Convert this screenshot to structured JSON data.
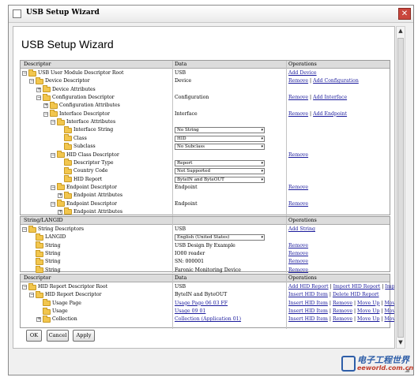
{
  "window": {
    "title": "USB Setup Wizard",
    "close_glyph": "✕"
  },
  "heading": "USB Setup Wizard",
  "descriptor_panel": {
    "columns": [
      "Descriptor",
      "Data",
      "Operations"
    ],
    "rows": [
      {
        "level": 0,
        "exp": "−",
        "label": "USB User Module Descriptor Root",
        "data": "USB",
        "data_type": "text",
        "ops": [
          {
            "label": "Add Device",
            "link": true
          }
        ]
      },
      {
        "level": 1,
        "exp": "−",
        "label": "Device Descriptor",
        "data": "Device",
        "data_type": "text",
        "ops": [
          {
            "label": "Remove",
            "link": true
          },
          {
            "label": " | ",
            "link": false
          },
          {
            "label": "Add Configuration",
            "link": true
          }
        ]
      },
      {
        "level": 2,
        "exp": "+",
        "label": "Device Attributes",
        "data": "",
        "data_type": "text",
        "ops": []
      },
      {
        "level": 2,
        "exp": "−",
        "label": "Configuration Descriptor",
        "data": "Configuration",
        "data_type": "text",
        "ops": [
          {
            "label": "Remove",
            "link": true
          },
          {
            "label": " | ",
            "link": false
          },
          {
            "label": "Add Interface",
            "link": true
          }
        ]
      },
      {
        "level": 3,
        "exp": "+",
        "label": "Configuration Attributes",
        "data": "",
        "data_type": "text",
        "ops": []
      },
      {
        "level": 3,
        "exp": "−",
        "label": "Interface Descriptor",
        "data": "Interface",
        "data_type": "text",
        "ops": [
          {
            "label": "Remove",
            "link": true
          },
          {
            "label": " | ",
            "link": false
          },
          {
            "label": "Add Endpoint",
            "link": true
          }
        ]
      },
      {
        "level": 4,
        "exp": "−",
        "label": "Interface Attributes",
        "data": "",
        "data_type": "text",
        "ops": []
      },
      {
        "level": 5,
        "exp": "",
        "label": "Interface String",
        "data": "No String",
        "data_type": "select",
        "ops": []
      },
      {
        "level": 5,
        "exp": "",
        "label": "Class",
        "data": "HID",
        "data_type": "select",
        "ops": []
      },
      {
        "level": 5,
        "exp": "",
        "label": "Subclass",
        "data": "No Subclass",
        "data_type": "select",
        "ops": []
      },
      {
        "level": 4,
        "exp": "−",
        "label": "HID Class Descriptor",
        "data": "",
        "data_type": "text",
        "ops": [
          {
            "label": "Remove",
            "link": true
          }
        ]
      },
      {
        "level": 5,
        "exp": "",
        "label": "Descriptor Type",
        "data": "Report",
        "data_type": "select",
        "ops": []
      },
      {
        "level": 5,
        "exp": "",
        "label": "Country Code",
        "data": "Not Supported",
        "data_type": "select",
        "ops": []
      },
      {
        "level": 5,
        "exp": "",
        "label": "HID Report",
        "data": "ByteIN and ByteOUT",
        "data_type": "select",
        "ops": []
      },
      {
        "level": 4,
        "exp": "−",
        "label": "Endpoint Descriptor",
        "data": "Endpoint",
        "data_type": "text",
        "ops": [
          {
            "label": "Remove",
            "link": true
          }
        ]
      },
      {
        "level": 5,
        "exp": "+",
        "label": "Endpoint Attributes",
        "data": "",
        "data_type": "text",
        "ops": []
      },
      {
        "level": 4,
        "exp": "−",
        "label": "Endpoint Descriptor",
        "data": "Endpoint",
        "data_type": "text",
        "ops": [
          {
            "label": "Remove",
            "link": true
          }
        ]
      },
      {
        "level": 5,
        "exp": "+",
        "label": "Endpoint Attributes",
        "data": "",
        "data_type": "text",
        "ops": []
      }
    ]
  },
  "string_panel": {
    "columns": [
      "String/LANGID",
      "",
      "Operations"
    ],
    "rows": [
      {
        "level": 0,
        "exp": "−",
        "label": "String Descriptors",
        "data": "USB",
        "data_type": "text",
        "ops": [
          {
            "label": "Add String",
            "link": true
          }
        ]
      },
      {
        "level": 1,
        "exp": "",
        "label": "LANGID",
        "data": "English (United States)",
        "data_type": "select",
        "ops": []
      },
      {
        "level": 1,
        "exp": "",
        "label": "String",
        "data": "USB Design By Example",
        "data_type": "text",
        "ops": [
          {
            "label": "Remove",
            "link": true
          }
        ]
      },
      {
        "level": 1,
        "exp": "",
        "label": "String",
        "data": "IO00 reader",
        "data_type": "text",
        "ops": [
          {
            "label": "Remove",
            "link": true
          }
        ]
      },
      {
        "level": 1,
        "exp": "",
        "label": "String",
        "data": "SN: 000001",
        "data_type": "text",
        "ops": [
          {
            "label": "Remove",
            "link": true
          }
        ]
      },
      {
        "level": 1,
        "exp": "",
        "label": "String",
        "data": "Faronic Monitoring Device",
        "data_type": "text",
        "ops": [
          {
            "label": "Remove",
            "link": true
          }
        ]
      }
    ]
  },
  "hid_panel": {
    "columns": [
      "Descriptor",
      "Data",
      "Operations"
    ],
    "rows": [
      {
        "level": 0,
        "exp": "−",
        "label": "HID Report Descriptor Root",
        "data": "USB",
        "data_type": "text",
        "ops": [
          {
            "label": "Add HID Report",
            "link": true
          },
          {
            "label": " | ",
            "link": false
          },
          {
            "label": "Import HID Report",
            "link": true
          },
          {
            "label": " | ",
            "link": false
          },
          {
            "label": "Import HID Report Template",
            "link": true
          }
        ]
      },
      {
        "level": 1,
        "exp": "−",
        "label": "HID Report Descriptor",
        "data": "ByteIN and ByteOUT",
        "data_type": "text",
        "ops": [
          {
            "label": "Insert HID Item",
            "link": true
          },
          {
            "label": " | ",
            "link": false
          },
          {
            "label": "Delete HID Report",
            "link": true
          }
        ]
      },
      {
        "level": 2,
        "exp": "",
        "label": "Usage Page",
        "data": "Usage Page 06 03 FF",
        "data_type": "link",
        "ops": [
          {
            "label": "Insert HID Item",
            "link": true
          },
          {
            "label": " | ",
            "link": false
          },
          {
            "label": "Remove",
            "link": true
          },
          {
            "label": " | ",
            "link": false
          },
          {
            "label": "Move Up",
            "link": true
          },
          {
            "label": " | ",
            "link": false
          },
          {
            "label": "Move Down",
            "link": true
          }
        ]
      },
      {
        "level": 2,
        "exp": "",
        "label": "Usage",
        "data": "Usage 09 01",
        "data_type": "link",
        "ops": [
          {
            "label": "Insert HID Item",
            "link": true
          },
          {
            "label": " | ",
            "link": false
          },
          {
            "label": "Remove",
            "link": true
          },
          {
            "label": " | ",
            "link": false
          },
          {
            "label": "Move Up",
            "link": true
          },
          {
            "label": " | ",
            "link": false
          },
          {
            "label": "Move Down",
            "link": true
          }
        ]
      },
      {
        "level": 2,
        "exp": "+",
        "label": "Collection",
        "data": "Collection (Application 01)",
        "data_type": "link",
        "ops": [
          {
            "label": "Insert HID Item",
            "link": true
          },
          {
            "label": " | ",
            "link": false
          },
          {
            "label": "Remove",
            "link": true
          },
          {
            "label": " | ",
            "link": false
          },
          {
            "label": "Move Up",
            "link": true
          },
          {
            "label": " | ",
            "link": false
          },
          {
            "label": "Move Down",
            "link": true
          }
        ]
      }
    ]
  },
  "buttons": {
    "ok": "OK",
    "cancel": "Cancel",
    "apply": "Apply"
  },
  "watermark": {
    "line1": "电子工程世界",
    "line2": "eeworld.com.cn"
  }
}
